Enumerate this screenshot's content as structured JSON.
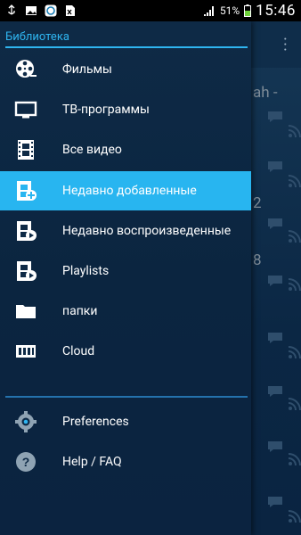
{
  "status": {
    "battery_percent": "51%",
    "time": "15:46"
  },
  "drawer": {
    "header": "Библиотека",
    "items": [
      {
        "label": "Фильмы",
        "icon": "film-reel-icon"
      },
      {
        "label": "ТВ-программы",
        "icon": "monitor-icon"
      },
      {
        "label": "Все видео",
        "icon": "film-strip-icon"
      },
      {
        "label": "Недавно добавленные",
        "icon": "film-add-icon",
        "selected": true
      },
      {
        "label": "Недавно воспроизведенные",
        "icon": "film-play-icon"
      },
      {
        "label": "Playlists",
        "icon": "playlist-icon"
      },
      {
        "label": "папки",
        "icon": "folder-icon"
      },
      {
        "label": "Cloud",
        "icon": "cloud-server-icon"
      }
    ],
    "footer_items": [
      {
        "label": "Preferences",
        "icon": "gear-icon"
      },
      {
        "label": "Help / FAQ",
        "icon": "help-icon"
      }
    ]
  },
  "background_list": {
    "fragments": [
      "ah -",
      "2",
      "8"
    ]
  },
  "colors": {
    "accent": "#28b5f0",
    "drawer_bg": "#0e2a46"
  }
}
